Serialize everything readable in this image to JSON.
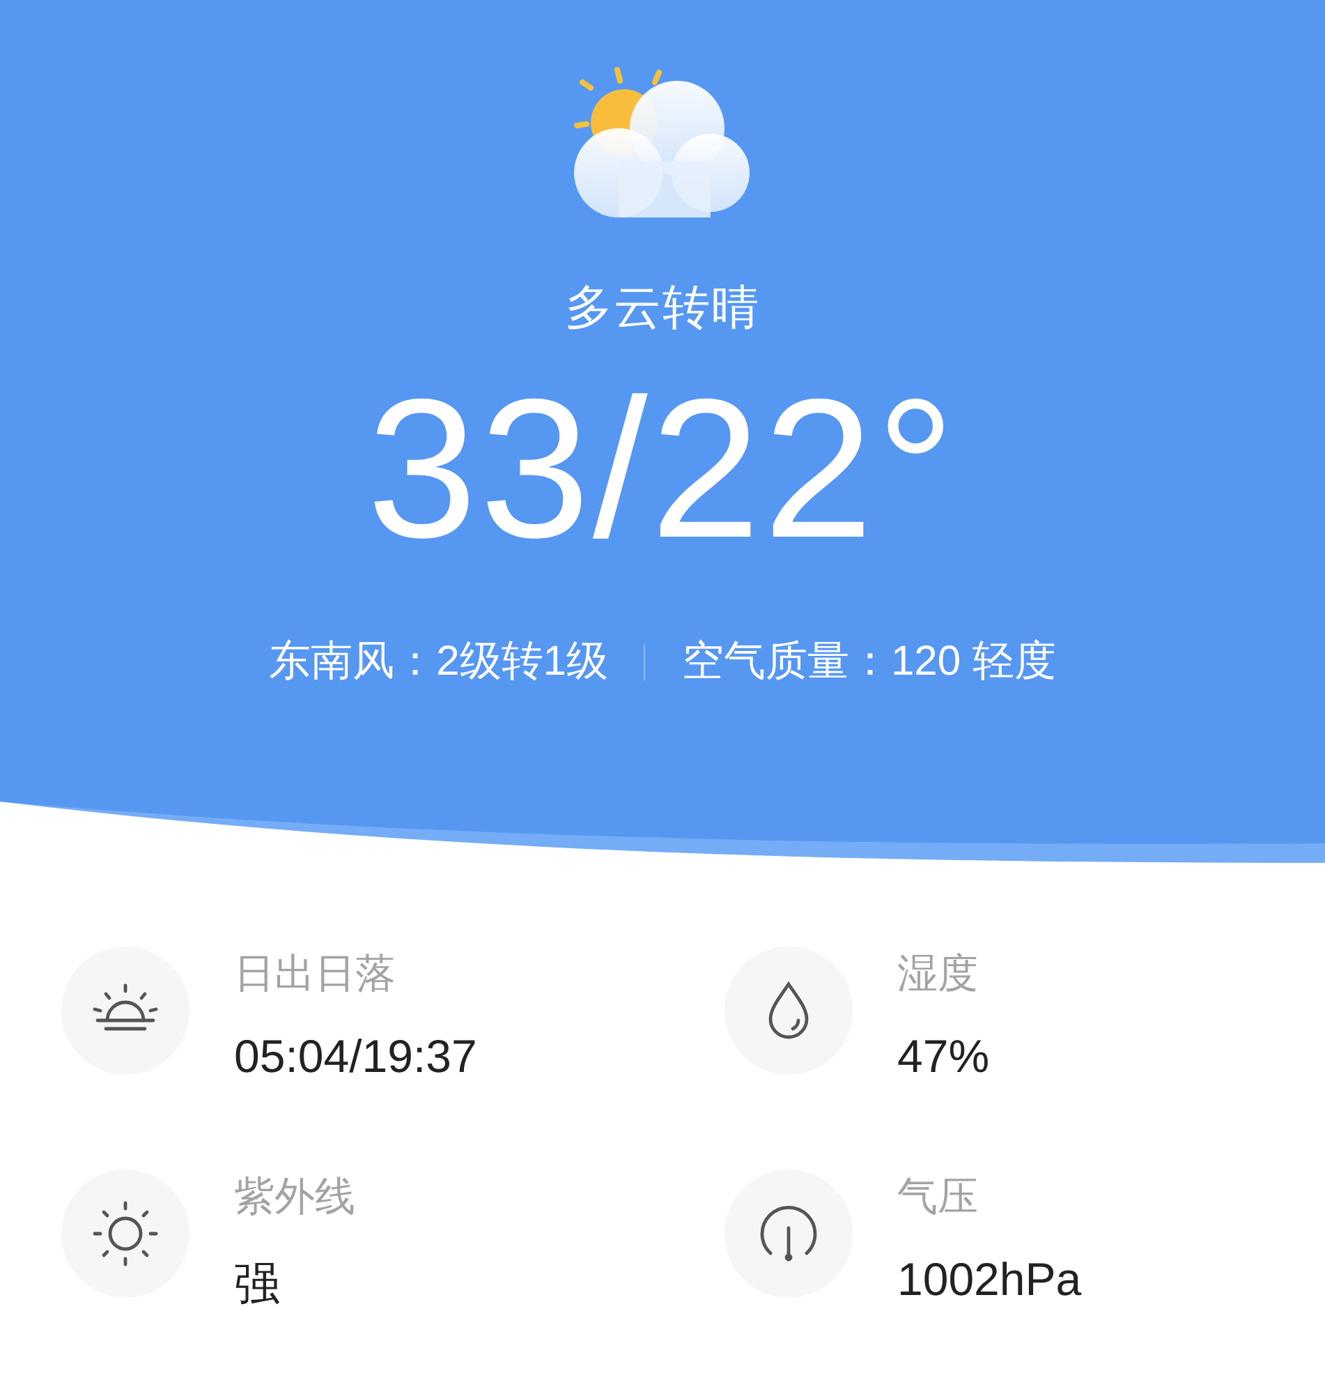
{
  "header": {
    "condition": "多云转晴",
    "temperature": "33/22°",
    "wind": "东南风：2级转1级",
    "air_quality": "空气质量：120 轻度"
  },
  "details": [
    {
      "kind": "sunrise",
      "label": "日出日落",
      "value": "05:04/19:37"
    },
    {
      "kind": "humidity",
      "label": "湿度",
      "value": "47%"
    },
    {
      "kind": "uv",
      "label": "紫外线",
      "value": "强"
    },
    {
      "kind": "pressure",
      "label": "气压",
      "value": "1002hPa"
    }
  ]
}
